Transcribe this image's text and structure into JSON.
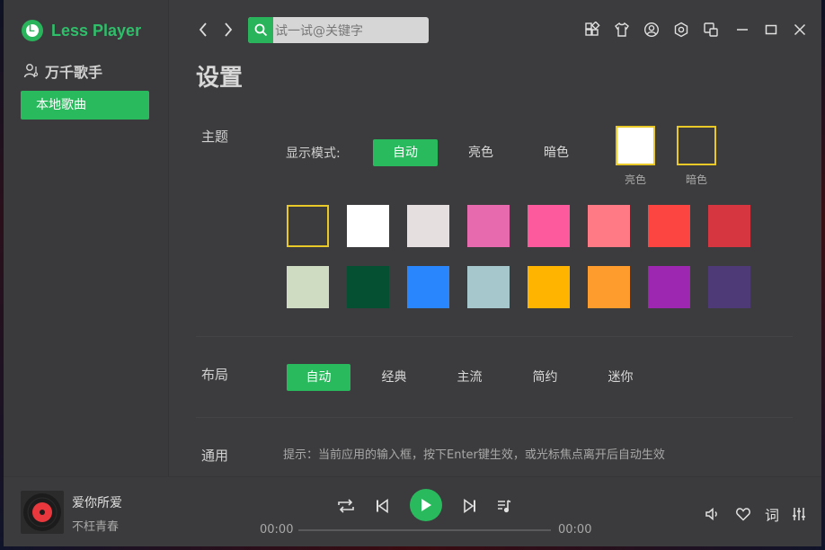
{
  "app": {
    "name": "Less Player"
  },
  "sidebar": {
    "artists_label": "万千歌手",
    "local_songs_label": "本地歌曲"
  },
  "header": {
    "search": {
      "placeholder": "试一试@关键字",
      "value": ""
    },
    "icons": [
      "theme-icon",
      "skin-icon",
      "user-icon",
      "settings-icon",
      "mini-window-icon"
    ],
    "window_controls": [
      "minimize-icon",
      "maximize-icon",
      "close-icon"
    ]
  },
  "settings": {
    "title": "设置",
    "theme": {
      "label": "主题",
      "display_mode_label": "显示模式:",
      "modes": [
        {
          "label": "自动",
          "active": true
        },
        {
          "label": "亮色",
          "active": false
        },
        {
          "label": "暗色",
          "active": false
        }
      ],
      "previews": [
        {
          "caption": "亮色",
          "color": "#ffffff"
        },
        {
          "caption": "暗色",
          "color": "#3c3c3e"
        }
      ],
      "swatches_row1": [
        "#3c3c3e",
        "#ffffff",
        "#e6dfe0",
        "#e86aae",
        "#fc5a9c",
        "#ff7a85",
        "#fc4440",
        "#d5363f"
      ],
      "swatches_row2": [
        "#cfdcc2",
        "#055033",
        "#2a86fc",
        "#a6c7cc",
        "#ffb400",
        "#ff9c2e",
        "#9e27b1",
        "#4f3a78"
      ],
      "selected_swatch": 0,
      "selected_border_color": "#e8c927"
    },
    "layout": {
      "label": "布局",
      "options": [
        {
          "label": "自动",
          "active": true
        },
        {
          "label": "经典",
          "active": false
        },
        {
          "label": "主流",
          "active": false
        },
        {
          "label": "简约",
          "active": false
        },
        {
          "label": "迷你",
          "active": false
        }
      ]
    },
    "general": {
      "label": "通用",
      "tip": "提示：当前应用的输入框，按下Enter键生效，或光标焦点离开后自动生效"
    }
  },
  "player": {
    "song_title": "爱你所爱",
    "artist": "不枉青春",
    "current_time": "00:00",
    "total_time": "00:00",
    "lyrics_label": "词",
    "progress": 0
  },
  "colors": {
    "accent": "#2aba5e",
    "background": "#3c3c3e"
  }
}
